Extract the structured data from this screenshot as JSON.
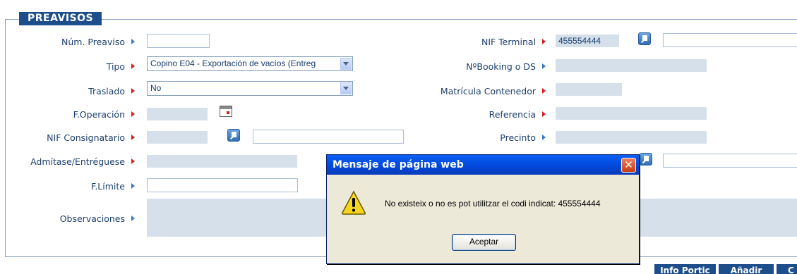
{
  "section": {
    "legend": "PREAVISOS"
  },
  "left_fields": {
    "num_preaviso": {
      "label": "Núm. Preaviso",
      "value": ""
    },
    "tipo": {
      "label": "Tipo",
      "selected": "Copino E04 - Exportación de vacíos (Entreg"
    },
    "traslado": {
      "label": "Traslado",
      "selected": "No"
    },
    "f_operacion": {
      "label": "F.Operación",
      "value": ""
    },
    "nif_consignatario": {
      "label": "NIF Consignatario",
      "value": "",
      "name_value": ""
    },
    "admitase": {
      "label": "Admítase/Entréguese",
      "value": ""
    },
    "f_limite": {
      "label": "F.Límite",
      "value": ""
    },
    "observaciones": {
      "label": "Observaciones",
      "value": ""
    }
  },
  "right_fields": {
    "nif_terminal": {
      "label": "NIF Terminal",
      "value": "455554444",
      "name_value": ""
    },
    "booking": {
      "label": "NºBooking o DS",
      "value": ""
    },
    "matricula": {
      "label": "Matrícula Contenedor",
      "value": ""
    },
    "referencia": {
      "label": "Referencia",
      "value": ""
    },
    "precinto": {
      "label": "Precinto",
      "value": ""
    },
    "extra_name_value": ""
  },
  "dialog": {
    "title": "Mensaje de página web",
    "message": "No existeix o no es pot utilitzar el codi indicat: 455554444",
    "ok_label": "Aceptar"
  },
  "bottom_buttons": {
    "info_portic": "Info Portic",
    "anadir": "Añadir",
    "third": "C"
  },
  "colors": {
    "brand": "#1d4e8c",
    "required_arrow": "#d62020",
    "optional_arrow": "#3b7ac0",
    "readonly_field": "#d5e0ea"
  }
}
